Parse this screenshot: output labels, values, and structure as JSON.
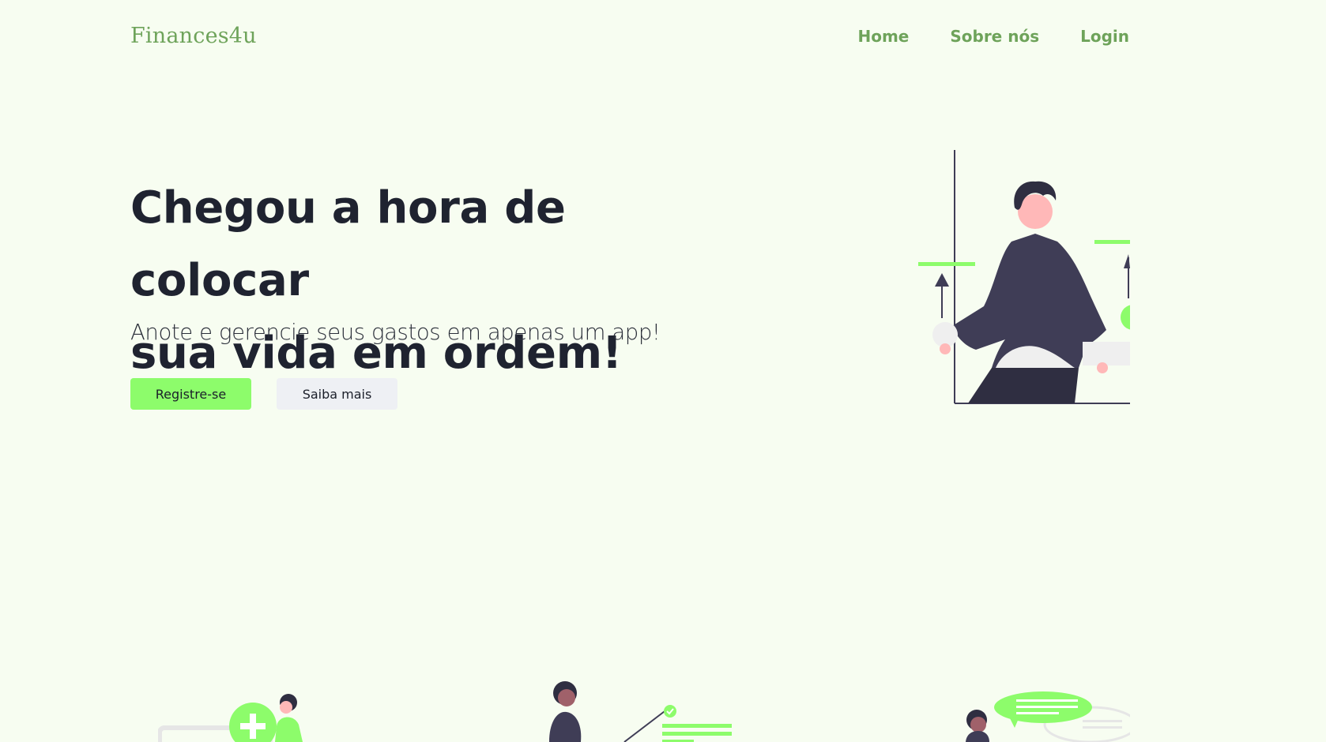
{
  "header": {
    "brand": "Finances4u",
    "nav": {
      "home": "Home",
      "about": "Sobre nós",
      "login": "Login"
    }
  },
  "hero": {
    "title_line1": "Chegou a hora de colocar",
    "title_line2": "sua vida em ordem!",
    "subtitle": "Anote e gerencie seus gastos em apenas um app!",
    "primary_button": "Registre-se",
    "secondary_button": "Saiba mais"
  },
  "colors": {
    "background": "#f7fdf1",
    "brand": "#6ea35a",
    "accent": "#8dfc6b",
    "text_dark": "#1f2330",
    "secondary_button": "#eef0f4"
  }
}
